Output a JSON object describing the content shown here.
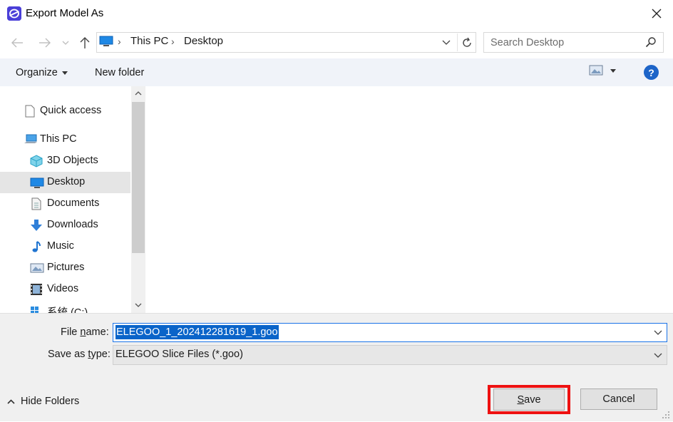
{
  "window": {
    "title": "Export Model As"
  },
  "address_bar": {
    "breadcrumbs": [
      "This PC",
      "Desktop"
    ]
  },
  "search": {
    "placeholder": "Search Desktop"
  },
  "toolbar": {
    "organize_label": "Organize",
    "new_folder_label": "New folder",
    "help_label": "?"
  },
  "nav_pane": {
    "items": [
      {
        "label": "Quick access",
        "icon": "quick-access-icon"
      },
      {
        "label": "This PC",
        "icon": "computer-icon"
      },
      {
        "label": "3D Objects",
        "icon": "3d-objects-icon"
      },
      {
        "label": "Desktop",
        "icon": "desktop-icon",
        "selected": true
      },
      {
        "label": "Documents",
        "icon": "documents-icon"
      },
      {
        "label": "Downloads",
        "icon": "downloads-icon"
      },
      {
        "label": "Music",
        "icon": "music-icon"
      },
      {
        "label": "Pictures",
        "icon": "pictures-icon"
      },
      {
        "label": "Videos",
        "icon": "videos-icon"
      },
      {
        "label": "系统 (C:)",
        "icon": "drive-icon"
      }
    ]
  },
  "form": {
    "file_name_label_pre": "File ",
    "file_name_label_key": "n",
    "file_name_label_post": "ame:",
    "file_name_value": "ELEGOO_1_202412281619_1.goo",
    "save_type_label_pre": "Save as ",
    "save_type_label_key": "t",
    "save_type_label_post": "ype:",
    "save_type_value": "ELEGOO Slice Files (*.goo)"
  },
  "footer": {
    "hide_folders_label": "Hide Folders",
    "save_key": "S",
    "save_rest": "ave",
    "cancel_label": "Cancel"
  },
  "colors": {
    "accent": "#0a64c9",
    "highlight_border": "#ee1111",
    "selected_nav": "#e5e5e5"
  }
}
